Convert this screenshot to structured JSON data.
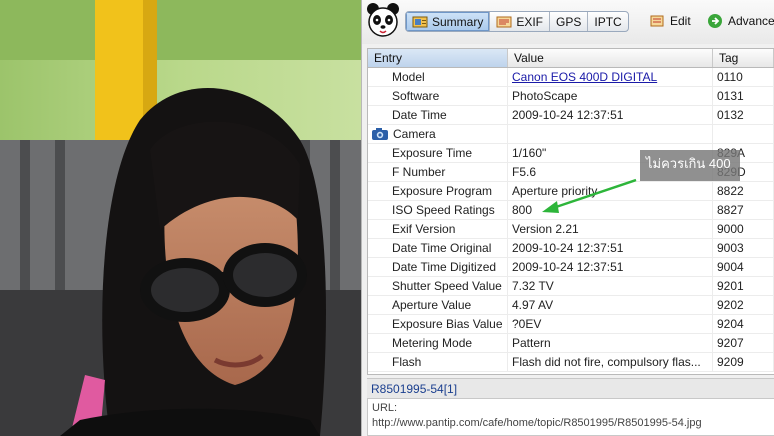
{
  "toolbar": {
    "tabs": [
      {
        "label": "Summary",
        "icon": "summary-icon",
        "active": true
      },
      {
        "label": "EXIF",
        "icon": "exif-icon",
        "active": false
      },
      {
        "label": "GPS",
        "icon": "",
        "active": false
      },
      {
        "label": "IPTC",
        "icon": "",
        "active": false
      }
    ],
    "edit_label": "Edit",
    "advance_label": "Advance"
  },
  "grid": {
    "headers": {
      "entry": "Entry",
      "value": "Value",
      "tag": "Tag"
    },
    "rows": [
      {
        "entry": "Model",
        "value": "Canon EOS 400D DIGITAL",
        "tag": "0110",
        "link": true
      },
      {
        "entry": "Software",
        "value": "PhotoScape",
        "tag": "0131"
      },
      {
        "entry": "Date Time",
        "value": "2009-10-24 12:37:51",
        "tag": "0132"
      },
      {
        "entry": "Camera",
        "value": "",
        "tag": "",
        "category": true
      },
      {
        "entry": "Exposure Time",
        "value": "1/160\"",
        "tag": "829A"
      },
      {
        "entry": "F Number",
        "value": "F5.6",
        "tag": "829D"
      },
      {
        "entry": "Exposure Program",
        "value": "Aperture priority",
        "tag": "8822"
      },
      {
        "entry": "ISO Speed Ratings",
        "value": "800",
        "tag": "8827"
      },
      {
        "entry": "Exif Version",
        "value": "Version 2.21",
        "tag": "9000"
      },
      {
        "entry": "Date Time Original",
        "value": "2009-10-24 12:37:51",
        "tag": "9003"
      },
      {
        "entry": "Date Time Digitized",
        "value": "2009-10-24 12:37:51",
        "tag": "9004"
      },
      {
        "entry": "Shutter Speed Value",
        "value": "7.32 TV",
        "tag": "9201"
      },
      {
        "entry": "Aperture Value",
        "value": "4.97 AV",
        "tag": "9202"
      },
      {
        "entry": "Exposure Bias Value",
        "value": "?0EV",
        "tag": "9204"
      },
      {
        "entry": "Metering Mode",
        "value": "Pattern",
        "tag": "9207"
      },
      {
        "entry": "Flash",
        "value": "Flash did not fire, compulsory flas...",
        "tag": "9209"
      }
    ]
  },
  "status": {
    "filename": "R8501995-54[1]"
  },
  "url": {
    "label": "URL:",
    "value": "http://www.pantip.com/cafe/home/topic/R8501995/R8501995-54.jpg"
  },
  "annotation": {
    "text": "ไม่ควรเกิน 400",
    "color": "#2db53a"
  },
  "colors": {
    "tab_active": "#a9c9ec",
    "link": "#1a1aa8",
    "status_text": "#1b3f8f"
  }
}
